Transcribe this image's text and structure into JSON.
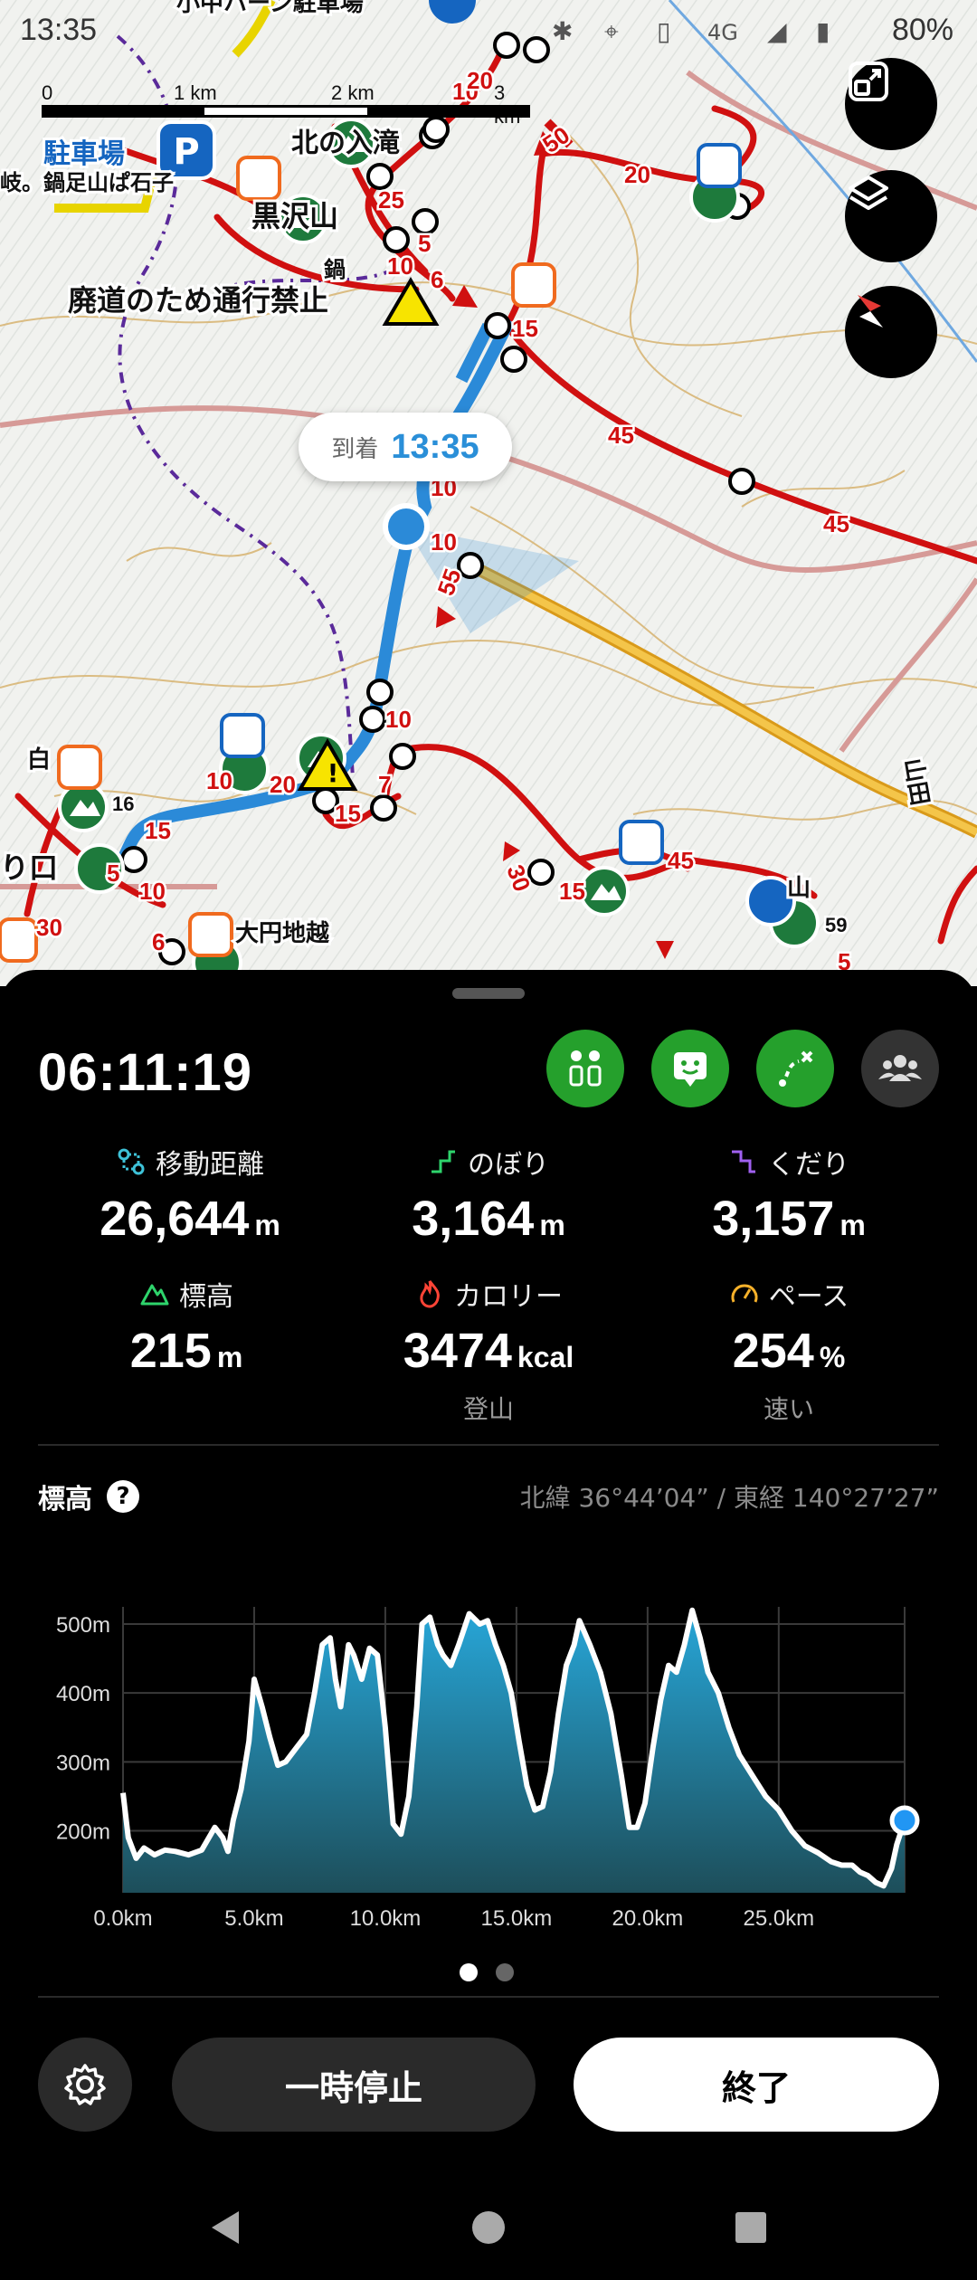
{
  "status_bar": {
    "time": "13:35",
    "battery": "80%",
    "network": "4G"
  },
  "map": {
    "scale": {
      "labels": [
        "0",
        "1 km",
        "2 km",
        "3 km"
      ]
    },
    "arrival": {
      "label": "到着",
      "time": "13:35"
    },
    "labels": {
      "parking": "駐車場",
      "trail1": "鍋足山ぱ石子",
      "kita": "北の入滝",
      "kurosawa": "黒沢山",
      "closed": "廃道のため通行禁止",
      "daien": "大円地越",
      "shiro": "白",
      "riguchi": "り口",
      "yama": "山",
      "sanda": "山田",
      "kanji_frag": "鍋",
      "edge": "岐。",
      "top_frag": "小中ハーン駐車場"
    },
    "segment_times": [
      "10",
      "25",
      "5",
      "10",
      "6",
      "15",
      "45",
      "45",
      "50",
      "20",
      "10",
      "55",
      "10",
      "7",
      "15",
      "20",
      "10",
      "16",
      "15",
      "10",
      "5",
      "6",
      "30",
      "30",
      "15",
      "45",
      "59",
      "5",
      "20",
      "10"
    ]
  },
  "panel": {
    "elapsed": "06:11:19",
    "stats": [
      {
        "label": "移動距離",
        "value": "26,644",
        "unit": "m",
        "sub": ""
      },
      {
        "label": "のぼり",
        "value": "3,164",
        "unit": "m",
        "sub": ""
      },
      {
        "label": "くだり",
        "value": "3,157",
        "unit": "m",
        "sub": ""
      },
      {
        "label": "標高",
        "value": "215",
        "unit": "m",
        "sub": ""
      },
      {
        "label": "カロリー",
        "value": "3474",
        "unit": "kcal",
        "sub": "登山"
      },
      {
        "label": "ペース",
        "value": "254",
        "unit": "%",
        "sub": "速い"
      }
    ],
    "elevation": {
      "title": "標高",
      "help": "?",
      "coords": "北緯 36°44’04” / 東経 140°27’27”"
    },
    "buttons": {
      "pause": "一時停止",
      "end": "終了"
    }
  },
  "chart_data": {
    "type": "area",
    "title": "標高",
    "x_unit": "km",
    "xlim": [
      0,
      29.8
    ],
    "ylim": [
      110,
      525
    ],
    "x_tick_labels": [
      "0.0km",
      "5.0km",
      "10.0km",
      "15.0km",
      "20.0km",
      "25.0km"
    ],
    "x_ticks": [
      0,
      5,
      10,
      15,
      20,
      25
    ],
    "y_tick_labels": [
      "200m",
      "300m",
      "400m",
      "500m"
    ],
    "y_ticks": [
      200,
      300,
      400,
      500
    ],
    "grid": true,
    "fill_color": "#27a6d8",
    "line_color": "#ffffff",
    "current_marker_color": "#2196f3",
    "x": [
      0,
      0.2,
      0.5,
      0.8,
      1.2,
      1.6,
      2.0,
      2.5,
      3.0,
      3.5,
      3.8,
      4.0,
      4.2,
      4.5,
      4.8,
      5.0,
      5.3,
      5.6,
      5.9,
      6.2,
      6.6,
      7.0,
      7.3,
      7.6,
      7.9,
      8.1,
      8.3,
      8.6,
      8.8,
      9.1,
      9.4,
      9.7,
      10.0,
      10.3,
      10.6,
      10.9,
      11.2,
      11.4,
      11.7,
      12.0,
      12.2,
      12.5,
      12.8,
      13.2,
      13.6,
      13.9,
      14.2,
      14.5,
      14.8,
      15.1,
      15.4,
      15.7,
      16.0,
      16.3,
      16.6,
      16.9,
      17.2,
      17.4,
      17.8,
      18.2,
      18.6,
      19.0,
      19.3,
      19.6,
      19.9,
      20.2,
      20.5,
      20.8,
      21.1,
      21.4,
      21.7,
      22.0,
      22.3,
      22.7,
      23.1,
      23.5,
      24.0,
      24.5,
      25.0,
      25.5,
      26.0,
      26.5,
      27.0,
      27.4,
      27.8,
      28.1,
      28.4,
      28.7,
      29.0,
      29.3,
      29.5,
      29.8
    ],
    "y": [
      255,
      190,
      160,
      175,
      165,
      172,
      170,
      165,
      172,
      205,
      190,
      170,
      215,
      260,
      330,
      420,
      380,
      335,
      295,
      300,
      320,
      340,
      400,
      470,
      480,
      420,
      380,
      470,
      455,
      420,
      465,
      455,
      350,
      210,
      195,
      250,
      380,
      500,
      510,
      470,
      455,
      440,
      470,
      515,
      500,
      505,
      470,
      440,
      400,
      330,
      265,
      230,
      235,
      285,
      370,
      440,
      470,
      505,
      470,
      430,
      370,
      280,
      205,
      205,
      240,
      320,
      390,
      440,
      430,
      470,
      520,
      480,
      430,
      400,
      350,
      310,
      280,
      250,
      230,
      200,
      178,
      168,
      155,
      150,
      150,
      140,
      135,
      125,
      120,
      145,
      180,
      215
    ]
  }
}
